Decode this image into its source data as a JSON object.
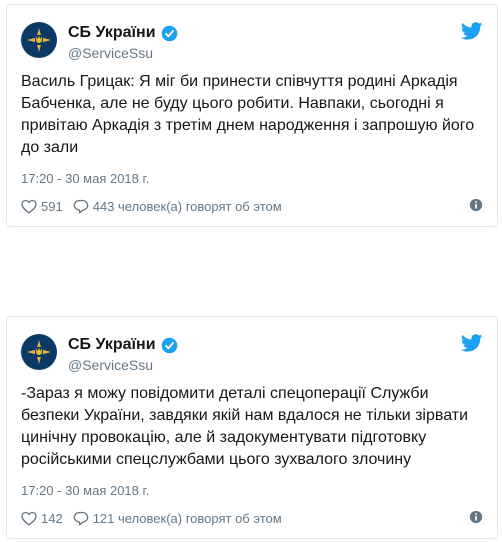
{
  "tweets": [
    {
      "display_name": "СБ України",
      "handle": "@ServiceSsu",
      "text": "Василь Грицак: Я міг би принести співчуття родині Аркадія Бабченка, але не буду цього робити. Навпаки, сьогодні я привітаю Аркадія з третім днем народження і запрошую його до зали",
      "timestamp": "17:20 - 30 мая 2018 г.",
      "likes": "591",
      "replies_text": "443 человек(а) говорят об этом"
    },
    {
      "display_name": "СБ України",
      "handle": "@ServiceSsu",
      "text": "-Зараз я можу повідомити деталі спецоперації Служби безпеки України, завдяки якій нам вдалося не тільки зірвати цинічну провокацію, але й задокументувати підготовку російськими спецслужбами цього зухвалого злочину",
      "timestamp": "17:20 - 30 мая 2018 г.",
      "likes": "142",
      "replies_text": "121 человек(а) говорят об этом"
    }
  ],
  "icons": {
    "avatar": "ssu-emblem-icon",
    "verified": "verified-badge-icon",
    "brand": "twitter-bird-icon",
    "like": "heart-icon",
    "reply": "speech-bubble-icon",
    "info": "info-icon"
  },
  "colors": {
    "brand_blue": "#1da1f2",
    "avatar_bg": "#0b3a66",
    "emblem_gold": "#e7b53b",
    "muted_text": "#657786"
  }
}
